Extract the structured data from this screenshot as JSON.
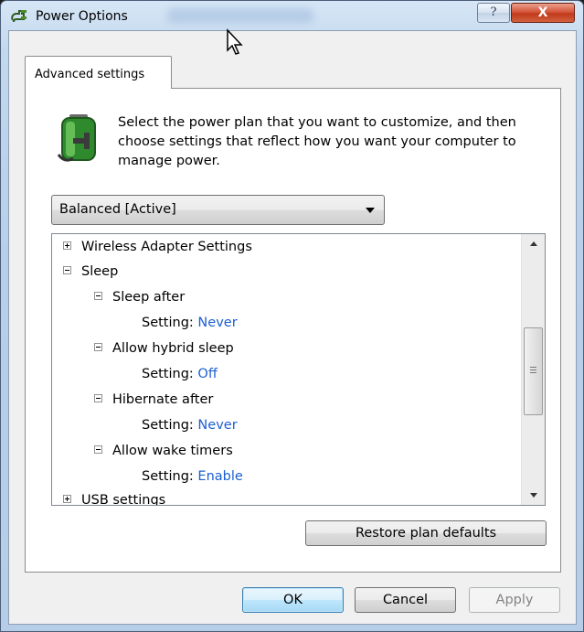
{
  "window": {
    "title": "Power Options",
    "help_glyph": "?",
    "close_glyph": "X"
  },
  "tab": {
    "label": "Advanced settings"
  },
  "description": "Select the power plan that you want to customize, and then choose settings that reflect how you want your computer to manage power.",
  "plan_select": {
    "selected": "Balanced [Active]"
  },
  "tree": {
    "wireless": "Wireless Adapter Settings",
    "sleep": "Sleep",
    "sleep_after": "Sleep after",
    "sleep_after_setting_label": "Setting:",
    "sleep_after_value": "Never",
    "hybrid": "Allow hybrid sleep",
    "hybrid_setting_label": "Setting:",
    "hybrid_value": "Off",
    "hibernate": "Hibernate after",
    "hibernate_setting_label": "Setting:",
    "hibernate_value": "Never",
    "wake": "Allow wake timers",
    "wake_setting_label": "Setting:",
    "wake_value": "Enable",
    "usb": "USB settings"
  },
  "buttons": {
    "restore": "Restore plan defaults",
    "ok": "OK",
    "cancel": "Cancel",
    "apply": "Apply"
  },
  "icons": {
    "title": "power-plug-icon",
    "plan": "battery-plug-icon",
    "cursor": "mouse-cursor-icon"
  },
  "colors": {
    "setting_value": "#1c5fd0",
    "close_button": "#c03a1b",
    "ok_button_border": "#3c7fb1"
  }
}
